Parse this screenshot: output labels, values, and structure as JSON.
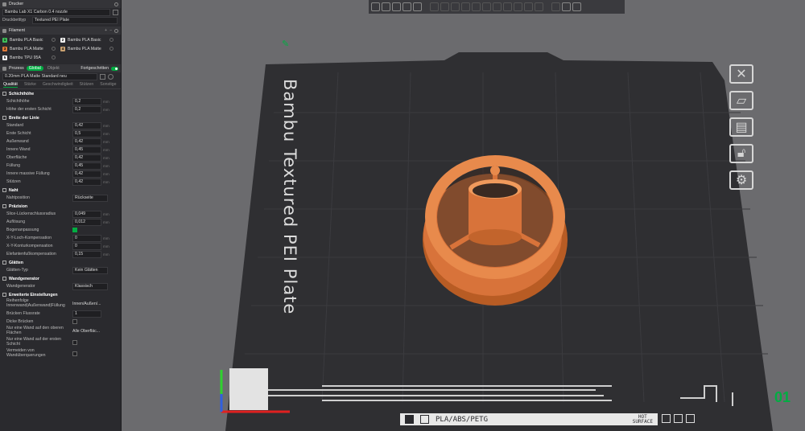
{
  "printer": {
    "header": "Drucker",
    "printer_name": "Bambu Lab X1 Carbon 0.4 nozzle",
    "plate_type_label": "Druckbetttyp",
    "plate_type_value": "Textured PEI Plate"
  },
  "filament": {
    "header": "Filament",
    "items": [
      {
        "num": "1",
        "name": "Bambu PLA Basic",
        "color": "#3fbf5a"
      },
      {
        "num": "2",
        "name": "Bambu PLA Basic",
        "color": "#f2f2f2"
      },
      {
        "num": "3",
        "name": "Bambu PLA Matte",
        "color": "#e07a3a"
      },
      {
        "num": "4",
        "name": "Bambu PLA Matte",
        "color": "#c8a070"
      },
      {
        "num": "5",
        "name": "Bambu TPU 95A",
        "color": "#f2f2f2"
      }
    ]
  },
  "process": {
    "header": "Prozess",
    "global_label": "Global",
    "object_label": "Objekt",
    "advanced_label": "Fortgeschritten",
    "preset": "0.20mm PLA Matte Standard neu",
    "tabs": [
      "Qualität",
      "Stärke",
      "Geschwindigkeit",
      "Stützen",
      "Sonstige"
    ],
    "active_tab": "Qualität"
  },
  "groups": {
    "layer_height": {
      "title": "Schichthöhe",
      "rows": [
        {
          "label": "Schichthöhe",
          "value": "0,2",
          "unit": "mm"
        },
        {
          "label": "Höhe der ersten Schicht",
          "value": "0,2",
          "unit": "mm"
        }
      ]
    },
    "line_width": {
      "title": "Breite der Linie",
      "rows": [
        {
          "label": "Standard",
          "value": "0,42",
          "unit": "mm"
        },
        {
          "label": "Erste Schicht",
          "value": "0,5",
          "unit": "mm"
        },
        {
          "label": "Außenwand",
          "value": "0,42",
          "unit": "mm"
        },
        {
          "label": "Innere Wand",
          "value": "0,45",
          "unit": "mm"
        },
        {
          "label": "Oberfläche",
          "value": "0,42",
          "unit": "mm"
        },
        {
          "label": "Füllung",
          "value": "0,45",
          "unit": "mm"
        },
        {
          "label": "Innere massive Füllung",
          "value": "0,42",
          "unit": "mm"
        },
        {
          "label": "Stützen",
          "value": "0,42",
          "unit": "mm"
        }
      ]
    },
    "seam": {
      "title": "Naht",
      "rows": [
        {
          "label": "Nahtposition",
          "value": "Rückseite"
        }
      ]
    },
    "precision": {
      "title": "Präzision",
      "rows": [
        {
          "label": "Slice-Lückenschlussradius",
          "value": "0,049",
          "unit": "mm"
        },
        {
          "label": "Auflösung",
          "value": "0,012",
          "unit": "mm"
        },
        {
          "label": "Bogenanpassung",
          "checked": true
        },
        {
          "label": "X-Y-Loch-Kompensation",
          "value": "0",
          "unit": "mm"
        },
        {
          "label": "X-Y-Konturkompensation",
          "value": "0",
          "unit": "mm"
        },
        {
          "label": "Elefantenfußkompensation",
          "value": "0,15",
          "unit": "mm"
        }
      ]
    },
    "ironing": {
      "title": "Glätten",
      "rows": [
        {
          "label": "Glätten-Typ",
          "value": "Kein Glätten"
        }
      ]
    },
    "wall_generator": {
      "title": "Wandgenerator",
      "rows": [
        {
          "label": "Wandgenerator",
          "value": "Klassisch"
        }
      ]
    },
    "advanced": {
      "title": "Erweiterte Einstellungen",
      "order_label": "Reihenfolge Innenwand|Außenwand|Füllung",
      "order_value": "Innen/Außen/...",
      "bridge_flow_label": "Brücken Flussrate",
      "bridge_flow_value": "1",
      "thick_bridges_label": "Dicke Brücken",
      "one_wall_top_label": "Nur eine Wand auf den oberen Flächen",
      "one_wall_top_value": "Alle Oberfläc...",
      "one_wall_first_label": "Nur eine Wand auf der ersten Schicht",
      "avoid_crossing_label": "Vermeiden von Wandüberquerungen"
    }
  },
  "plate": {
    "title": "Bambu Textured PEI Plate",
    "material_text": "PLA/ABS/PETG",
    "hot_line1": "HOT",
    "hot_line2": "SURFACE",
    "plate_number": "01"
  },
  "colors": {
    "accent": "#00ae42",
    "model": "#e07a3a",
    "bed": "#2f2f32"
  }
}
